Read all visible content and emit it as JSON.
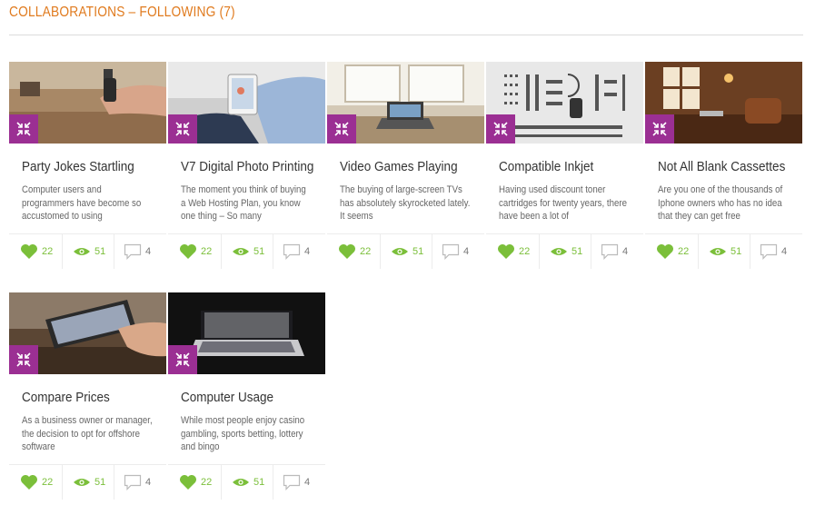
{
  "page": {
    "title": "COLLABORATIONS – FOLLOWING (7)"
  },
  "colors": {
    "title": "#e07b1f",
    "badge": "#9b2f93",
    "stat_green": "#7bbf3a",
    "stat_gray": "#777777"
  },
  "cards": [
    {
      "title": "Party Jokes Startling",
      "description": "Computer users and programmers have become so accustomed to using",
      "likes": "22",
      "views": "51",
      "comments": "4",
      "image": "hand-phone-on-wooden-desk"
    },
    {
      "title": "V7 Digital Photo Printing",
      "description": "The moment you think of buying a Web Hosting Plan, you know one thing – So many",
      "likes": "22",
      "views": "51",
      "comments": "4",
      "image": "person-with-tablet"
    },
    {
      "title": "Video Games Playing",
      "description": "The buying of large-screen TVs has absolutely skyrocketed lately. It seems",
      "likes": "22",
      "views": "51",
      "comments": "4",
      "image": "laptop-by-window"
    },
    {
      "title": "Compatible Inkjet",
      "description": "Having used discount toner cartridges for twenty years, there have been a lot of",
      "likes": "22",
      "views": "51",
      "comments": "4",
      "image": "disassembled-parts-layout"
    },
    {
      "title": "Not All Blank Cassettes",
      "description": "Are you one of the thousands of Iphone owners who has no idea that they can get free",
      "likes": "22",
      "views": "51",
      "comments": "4",
      "image": "cafe-interior"
    },
    {
      "title": "Compare Prices",
      "description": "As a business owner or manager, the decision to opt for offshore software",
      "likes": "22",
      "views": "51",
      "comments": "4",
      "image": "hand-holding-smartphone"
    },
    {
      "title": "Computer Usage",
      "description": "While most people enjoy casino gambling, sports betting, lottery and bingo",
      "likes": "22",
      "views": "51",
      "comments": "4",
      "image": "glowing-laptop-keyboard-dark"
    }
  ]
}
